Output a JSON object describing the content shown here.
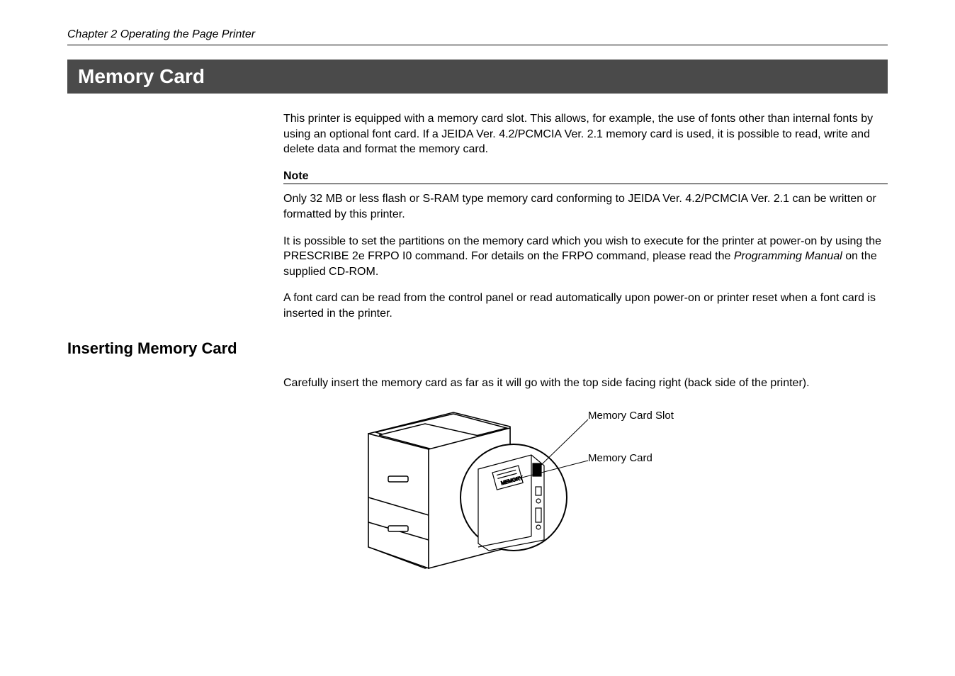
{
  "chapter_header": "Chapter 2  Operating the Page Printer",
  "section_title": "Memory Card",
  "intro_paragraph": "This printer is equipped with a memory card slot.  This allows, for example, the use of fonts other than internal fonts by using an optional font card.  If a JEIDA Ver. 4.2/PCMCIA Ver. 2.1 memory card is   used, it is possible to read, write and delete data and format the memory card.",
  "note_label": "Note",
  "note_paragraph": "Only 32 MB or less flash or S-RAM type memory card conforming to JEIDA Ver. 4.2/PCMCIA Ver. 2.1 can be written or formatted by this printer.",
  "frpo_pre": "It is possible to set the partitions on the memory card which you wish to execute for the printer at power-on by using the PRESCRIBE 2e FRPO I0 command.  For details on the FRPO command, please read the ",
  "frpo_italic": "Programming Manual",
  "frpo_post": " on the supplied CD-ROM.",
  "font_card_paragraph": "A font card can be read from the control panel or read automatically upon power-on or printer reset when a font card is inserted in the printer.",
  "subsection_title": "Inserting Memory Card",
  "insert_paragraph": "Carefully insert the memory card as far as it will go with the top side facing right (back side of the printer).",
  "callout_slot": "Memory Card Slot",
  "callout_card": "Memory Card"
}
